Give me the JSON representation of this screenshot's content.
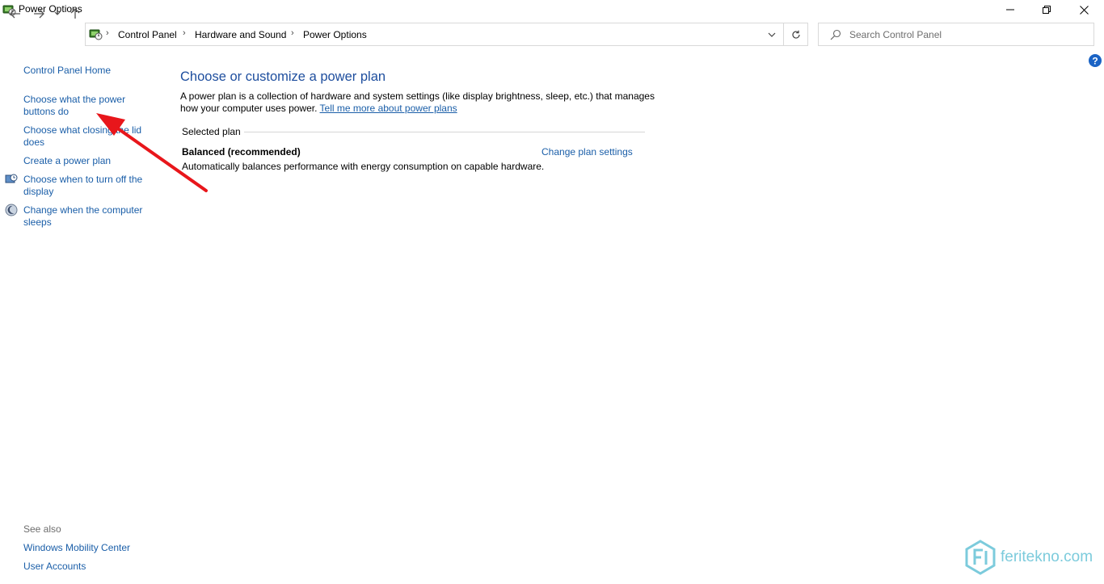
{
  "window": {
    "title": "Power Options",
    "app_icon": "power-options-icon",
    "controls": {
      "minimize": "minimize-icon",
      "restore": "restore-icon",
      "close": "close-icon"
    }
  },
  "navigation": {
    "back": "back-arrow-icon",
    "forward": "forward-arrow-icon",
    "recent": "chevron-down-icon",
    "up": "up-arrow-icon"
  },
  "address": {
    "breadcrumbs": [
      "Control Panel",
      "Hardware and Sound",
      "Power Options"
    ]
  },
  "search": {
    "placeholder": "Search Control Panel"
  },
  "left_pane": {
    "home": "Control Panel Home",
    "links": [
      "Choose what the power buttons do",
      "Choose what closing the lid does",
      "Create a power plan",
      "Choose when to turn off the display",
      "Change when the computer sleeps"
    ],
    "see_also_heading": "See also",
    "see_also": [
      "Windows Mobility Center",
      "User Accounts"
    ]
  },
  "main": {
    "title": "Choose or customize a power plan",
    "description": "A power plan is a collection of hardware and system settings (like display brightness, sleep, etc.) that manages how your computer uses power.",
    "learn_more": "Tell me more about power plans",
    "selected_plan_label": "Selected plan",
    "plan": {
      "name": "Balanced (recommended)",
      "description": "Automatically balances performance with energy consumption on capable hardware.",
      "change_link": "Change plan settings"
    }
  },
  "watermark": {
    "text": "feritekno.com"
  },
  "colors": {
    "link": "#1a5ea8",
    "heading": "#1e4e9e",
    "annotation_arrow": "#e8161b",
    "watermark": "#7ccbdc"
  }
}
